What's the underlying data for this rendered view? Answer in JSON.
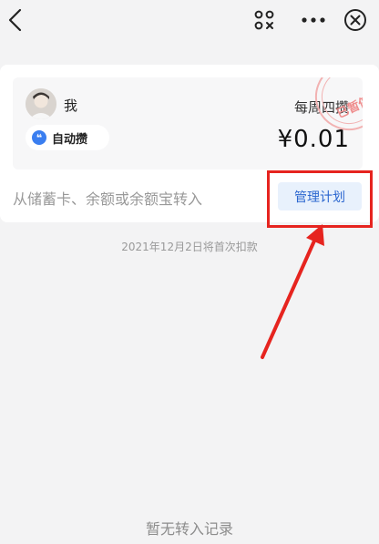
{
  "header": {
    "back_icon": "chevron-left-icon",
    "scan_icon": "scan-qr-icon",
    "more_icon": "more-horizontal-icon",
    "close_icon": "close-circle-icon"
  },
  "plan": {
    "owner_name": "我",
    "mode_label": "自动攒",
    "frequency": "每周四攒",
    "amount": "¥0.01",
    "status_stamp": "已暂停",
    "source_text": "从储蓄卡、余额或余额宝转入",
    "manage_label": "管理计划"
  },
  "first_debit_note": "2021年12月2日将首次扣款",
  "empty_records": "暂无转入记录",
  "colors": {
    "accent_blue": "#2a66cf",
    "highlight_red": "#e6241f",
    "stamp_red": "#ef8e8e",
    "background": "#f3f3f4"
  }
}
